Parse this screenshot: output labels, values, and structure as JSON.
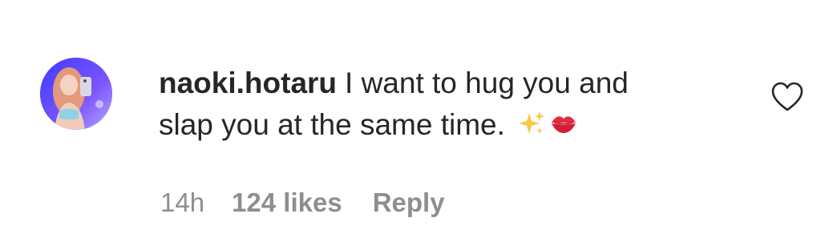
{
  "comment": {
    "username": "naoki.hotaru",
    "text_line1": "I want to hug you and",
    "text_line2": "slap you at the same time.",
    "emojis": [
      "sparkles",
      "kiss-mark-lips"
    ]
  },
  "meta": {
    "timestamp": "14h",
    "likes": "124 likes",
    "reply": "Reply"
  },
  "icons": {
    "like": "heart-outline-icon"
  },
  "colors": {
    "text": "#262626",
    "secondary": "#8e8e8e",
    "avatar_bg": "#6a4cff"
  }
}
